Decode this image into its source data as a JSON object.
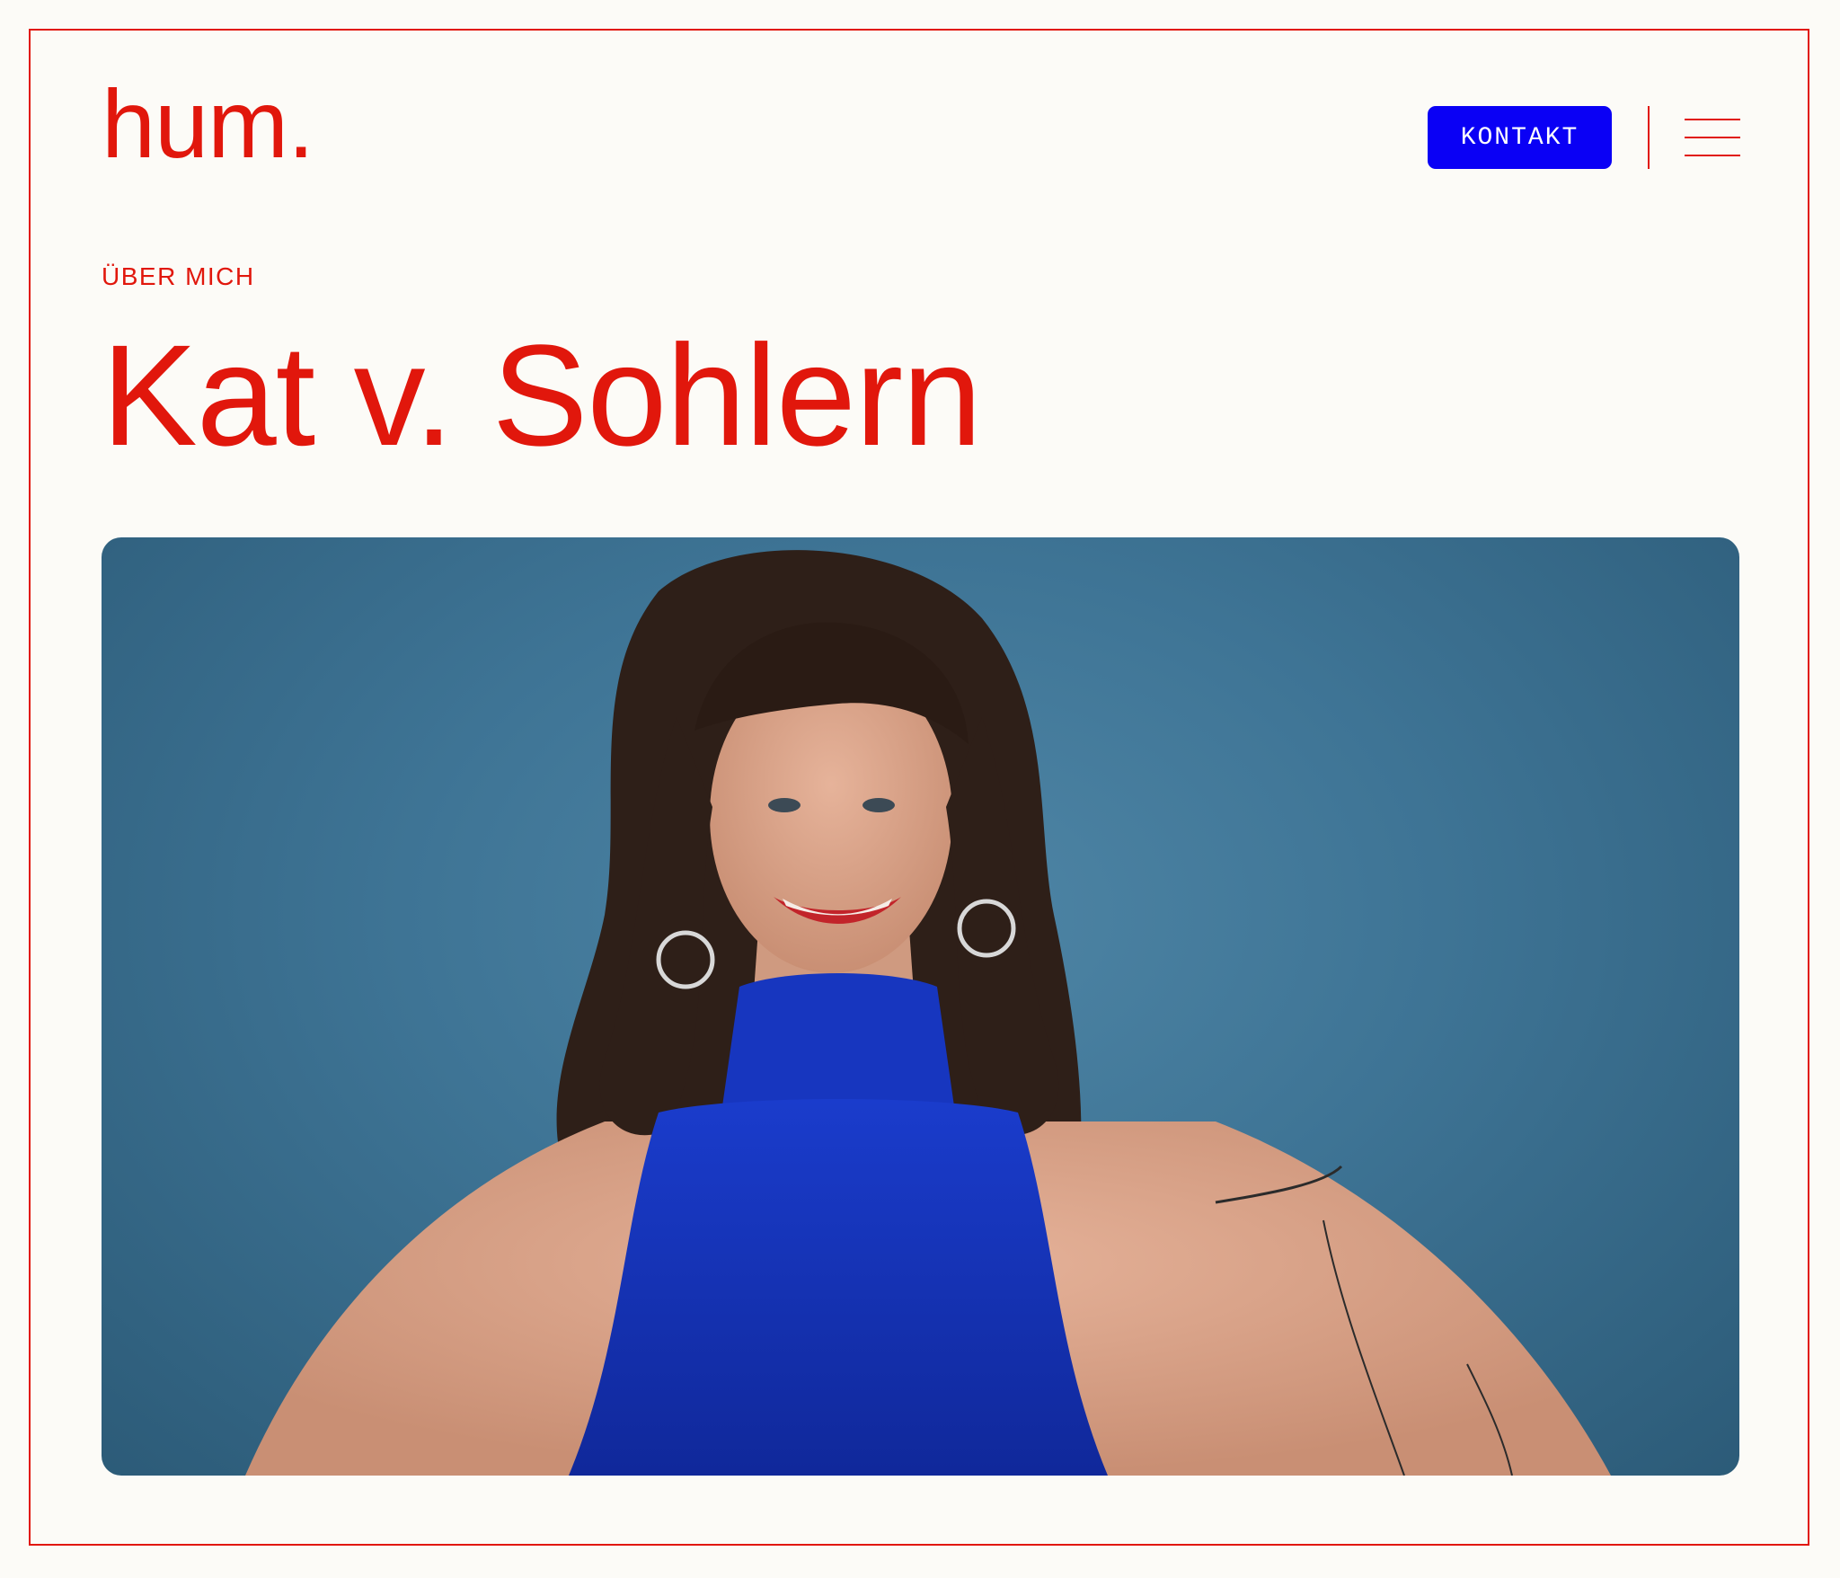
{
  "header": {
    "logo_text": "hum.",
    "contact_button_label": "KONTAKT",
    "menu_icon": "hamburger-menu-icon"
  },
  "main": {
    "eyebrow": "ÜBER MICH",
    "title": "Kat v. Sohlern",
    "photo": {
      "subject": "portrait-photo"
    }
  },
  "colors": {
    "accent": "#e1170c",
    "button": "#0a00f5",
    "background": "#fcfbf7",
    "photo_backdrop": "#3e7495",
    "sweater": "#1531b8"
  }
}
